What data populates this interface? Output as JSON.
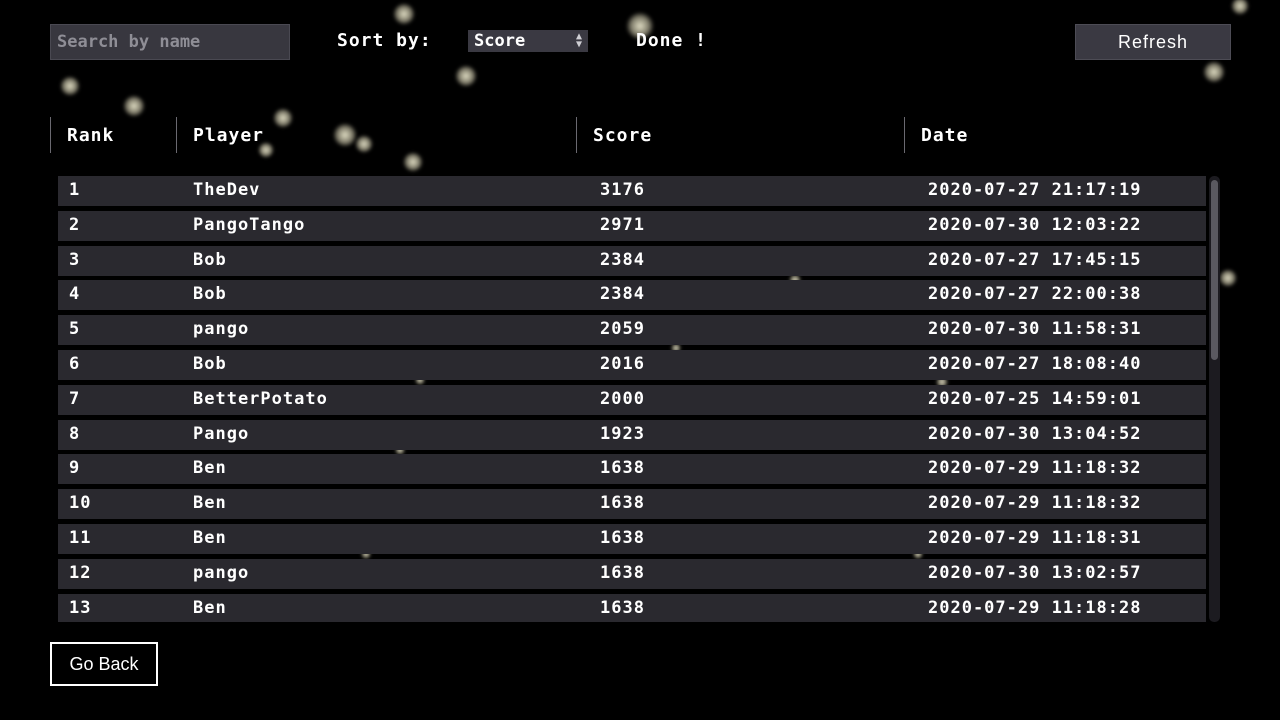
{
  "toolbar": {
    "search_placeholder": "Search by name",
    "search_value": "",
    "sort_label": "Sort by:",
    "sort_value": "Score",
    "status": "Done !",
    "refresh_label": "Refresh"
  },
  "table": {
    "columns": [
      "Rank",
      "Player",
      "Score",
      "Date"
    ],
    "rows": [
      {
        "rank": "1",
        "player": "TheDev",
        "score": "3176",
        "date": "2020-07-27 21:17:19"
      },
      {
        "rank": "2",
        "player": "PangoTango",
        "score": "2971",
        "date": "2020-07-30 12:03:22"
      },
      {
        "rank": "3",
        "player": "Bob",
        "score": "2384",
        "date": "2020-07-27 17:45:15"
      },
      {
        "rank": "4",
        "player": "Bob",
        "score": "2384",
        "date": "2020-07-27 22:00:38"
      },
      {
        "rank": "5",
        "player": "pango",
        "score": "2059",
        "date": "2020-07-30 11:58:31"
      },
      {
        "rank": "6",
        "player": "Bob",
        "score": "2016",
        "date": "2020-07-27 18:08:40"
      },
      {
        "rank": "7",
        "player": "BetterPotato",
        "score": "2000",
        "date": "2020-07-25 14:59:01"
      },
      {
        "rank": "8",
        "player": "Pango",
        "score": "1923",
        "date": "2020-07-30 13:04:52"
      },
      {
        "rank": "9",
        "player": "Ben",
        "score": "1638",
        "date": "2020-07-29 11:18:32"
      },
      {
        "rank": "10",
        "player": "Ben",
        "score": "1638",
        "date": "2020-07-29 11:18:32"
      },
      {
        "rank": "11",
        "player": "Ben",
        "score": "1638",
        "date": "2020-07-29 11:18:31"
      },
      {
        "rank": "12",
        "player": "pango",
        "score": "1638",
        "date": "2020-07-30 13:02:57"
      },
      {
        "rank": "13",
        "player": "Ben",
        "score": "1638",
        "date": "2020-07-29 11:18:28"
      }
    ]
  },
  "footer": {
    "go_back_label": "Go Back"
  },
  "colors": {
    "background": "#000000",
    "row_background": "#2a292f",
    "control_background": "#3a3942",
    "text": "#ffffff"
  }
}
